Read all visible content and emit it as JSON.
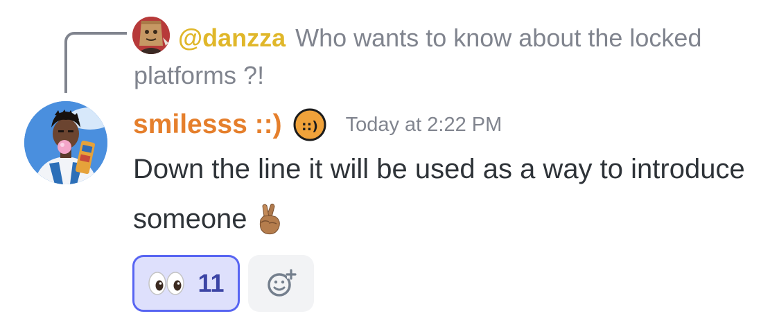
{
  "reply": {
    "author": "@danzza",
    "text": "Who wants to know about the locked platforms ?!",
    "author_color": "#e0b72a"
  },
  "message": {
    "author": "smilesss ::)",
    "author_color": "#e57f2c",
    "role_icon_text": "::)",
    "timestamp": "Today at 2:22 PM",
    "content": "Down the line it will be used as a way to introduce someone",
    "trailing_emoji": "crossed-fingers-emoji"
  },
  "reactions": [
    {
      "emoji": "eyes-emoji",
      "count": "11",
      "selected": true
    }
  ],
  "add_reaction": {
    "icon": "add-reaction-icon"
  },
  "colors": {
    "accent": "#5865f2",
    "reaction_bg": "#dee0fc",
    "muted_text": "#80848e",
    "body_text": "#2e3338"
  }
}
